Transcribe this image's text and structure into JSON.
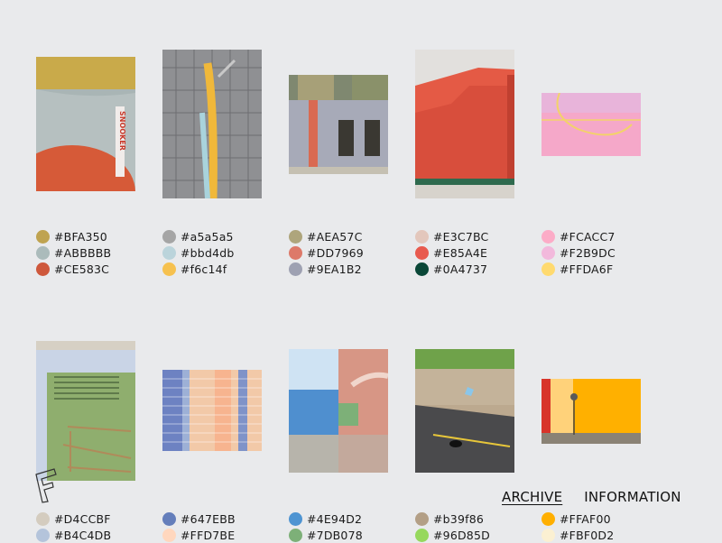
{
  "nav": {
    "archive": "ARCHIVE",
    "information": "INFORMATION"
  },
  "logo_letter": "F",
  "rows": [
    [
      {
        "photo": "snooker-wall",
        "sign": "SNOOKER",
        "colors": [
          "#BFA350",
          "#ABBBBB",
          "#CE583C"
        ]
      },
      {
        "photo": "pipes-grid",
        "colors": [
          "#a5a5a5",
          "#bbd4db",
          "#f6c14f"
        ]
      },
      {
        "photo": "corrugated-building",
        "colors": [
          "#AEA57C",
          "#DD7969",
          "#9EA1B2"
        ]
      },
      {
        "photo": "red-warehouse",
        "colors": [
          "#E3C7BC",
          "#E85A4E",
          "#0A4737"
        ]
      },
      {
        "photo": "pink-court",
        "colors": [
          "#FCACC7",
          "#F2B9DC",
          "#FFDA6F"
        ]
      }
    ],
    [
      {
        "photo": "green-vent-door",
        "colors": [
          "#D4CCBF",
          "#B4C4DB"
        ]
      },
      {
        "photo": "highrise-facade",
        "colors": [
          "#647EBB",
          "#FFD7BE"
        ]
      },
      {
        "photo": "blue-pink-walls",
        "colors": [
          "#4E94D2",
          "#7DB078"
        ]
      },
      {
        "photo": "street-wall",
        "colors": [
          "#b39f86",
          "#96D85D"
        ]
      },
      {
        "photo": "yellow-wall-sign",
        "colors": [
          "#FFAF00",
          "#FBF0D2"
        ]
      }
    ]
  ]
}
